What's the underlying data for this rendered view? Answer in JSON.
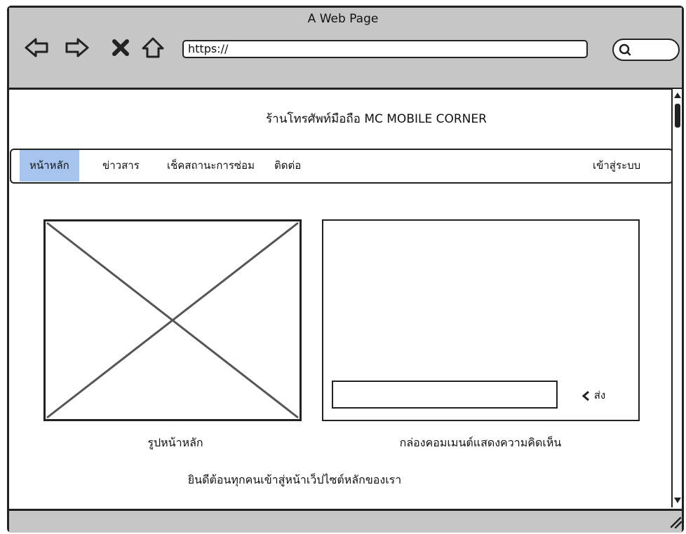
{
  "window": {
    "title": "A Web Page"
  },
  "browser": {
    "url": "https://",
    "icons": [
      "back-icon",
      "forward-icon",
      "stop-icon",
      "home-icon",
      "search-icon"
    ]
  },
  "site": {
    "title": "ร้านโทรศัพท์มือถือ MC MOBILE CORNER"
  },
  "menu": {
    "items": [
      "หน้าหลัก",
      "ข่าวสาร",
      "เช็คสถานะการซ่อม",
      "ติดต่อ"
    ],
    "active": "หน้าหลัก",
    "login": "เข้าสู่ระบบ"
  },
  "main": {
    "image_caption": "รูปหน้าหลัก",
    "comment_caption": "กล่องคอมเมนต์แสดงความคิดเห็น",
    "send_label": "ส่ง",
    "welcome": "ยินดีต้อนทุกคนเข้าสู่หน้าเว็ปไซต์หลักของเรา"
  },
  "colors": {
    "chrome": "#c6c6c6",
    "active_tab": "#a7c4ef",
    "ink": "#222222"
  }
}
